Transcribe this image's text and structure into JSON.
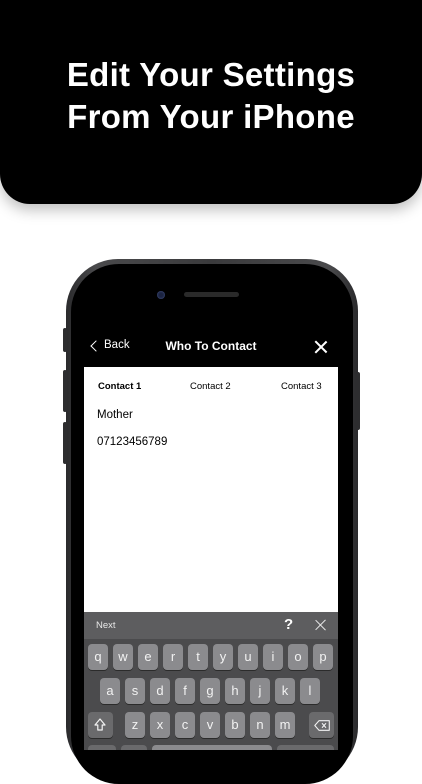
{
  "banner": {
    "line1": "Edit Your Settings",
    "line2": "From Your iPhone"
  },
  "navbar": {
    "back_label": "Back",
    "title": "Who To Contact"
  },
  "tabs": [
    "Contact 1",
    "Contact 2",
    "Contact 3"
  ],
  "active_tab": "Contact 1",
  "fields": {
    "name": "Mother",
    "phone": "07123456789"
  },
  "keyboard_accessory": {
    "next_label": "Next",
    "help_label": "?"
  },
  "keyboard": {
    "row1": [
      "q",
      "w",
      "e",
      "r",
      "t",
      "y",
      "u",
      "i",
      "o",
      "p"
    ],
    "row2": [
      "a",
      "s",
      "d",
      "f",
      "g",
      "h",
      "j",
      "k",
      "l"
    ],
    "row3": [
      "z",
      "x",
      "c",
      "v",
      "b",
      "n",
      "m"
    ]
  },
  "icons": [
    "chevron-left-icon",
    "close-icon",
    "shift-icon",
    "backspace-icon"
  ],
  "colors": {
    "banner_bg": "#000000",
    "nav_bg": "#000000",
    "keyboard_bg": "#4b4b4d",
    "key_bg": "#8b8b8e"
  }
}
